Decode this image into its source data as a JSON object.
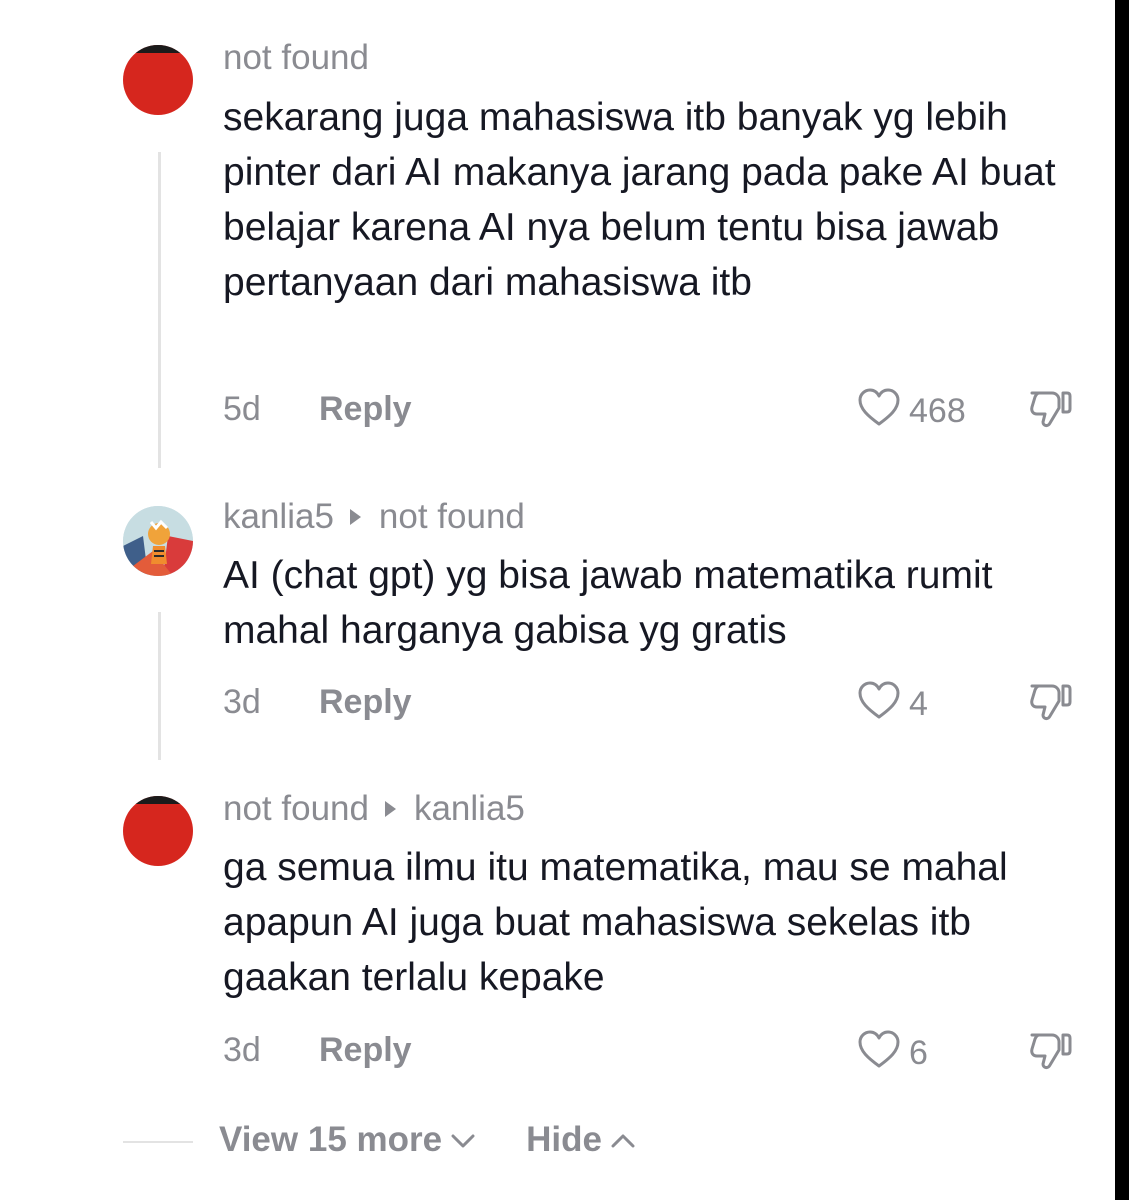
{
  "comments": [
    {
      "username": "not found",
      "reply_to": "",
      "text": "sekarang juga mahasiswa itb banyak yg lebih pinter dari AI makanya jarang pada pake AI buat belajar karena AI nya belum tentu bisa jawab pertanyaan dari mahasiswa itb",
      "age": "5d",
      "reply_label": "Reply",
      "likes": "468"
    },
    {
      "username": "kanlia5",
      "reply_to": "not found",
      "text": "AI (chat gpt) yg bisa jawab matematika rumit mahal harganya gabisa yg gratis",
      "age": "3d",
      "reply_label": "Reply",
      "likes": "4"
    },
    {
      "username": "not found",
      "reply_to": "kanlia5",
      "text": "ga semua ilmu itu matematika, mau se mahal apapun AI juga buat mahasiswa sekelas itb gaakan terlalu kepake",
      "age": "3d",
      "reply_label": "Reply",
      "likes": "6"
    }
  ],
  "footer": {
    "view_more": "View 15 more",
    "hide": "Hide"
  },
  "icons": {
    "like": "heart-outline-icon",
    "dislike": "thumbs-down-icon",
    "reply_arrow": "caret-right-icon",
    "view_more": "chevron-down-icon",
    "hide": "chevron-up-icon"
  },
  "colors": {
    "text": "#161823",
    "muted": "#8a8b91",
    "avatar_red": "#d6261e"
  }
}
